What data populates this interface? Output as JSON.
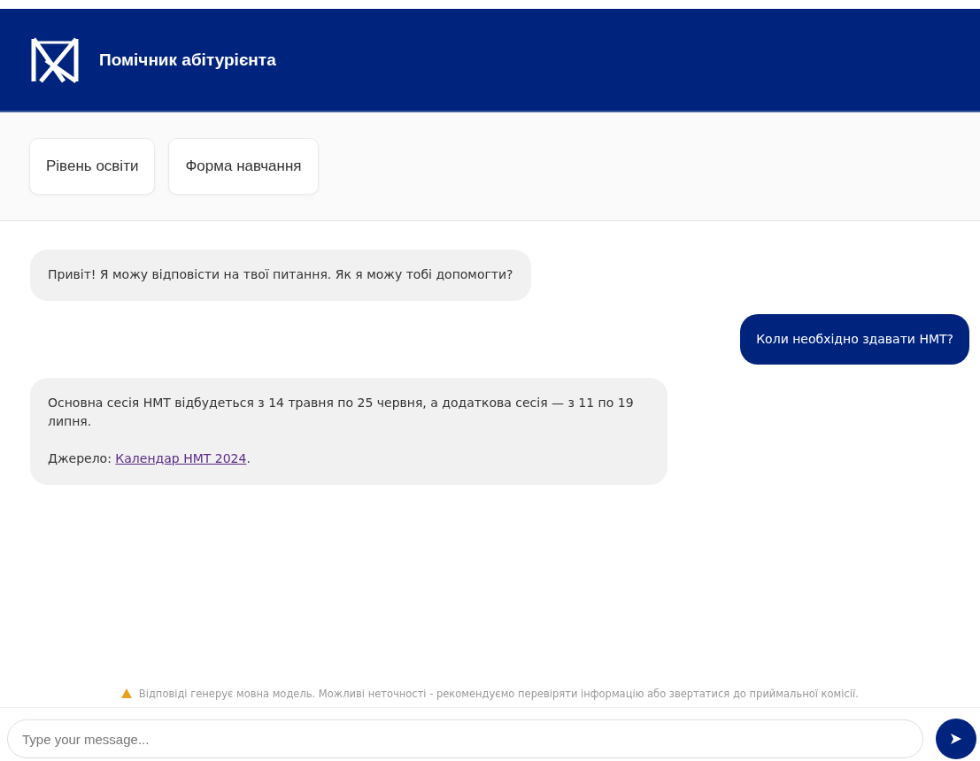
{
  "header": {
    "title": "Помічник абітурієнта"
  },
  "chips": [
    {
      "label": "Рівень освіти"
    },
    {
      "label": "Форма навчання"
    }
  ],
  "messages": [
    {
      "kind": "bot",
      "paragraphs": [
        {
          "text": "Привіт! Я можу відповісти на твої питання. Як я можу тобі допомогти?"
        }
      ]
    },
    {
      "kind": "user",
      "paragraphs": [
        {
          "text": "Коли необхідно здавати НМТ?"
        }
      ]
    },
    {
      "kind": "bot",
      "paragraphs": [
        {
          "text": "Основна сесія НМТ відбудеться з 14 травня по 25 червня, а додаткова сесія — з 11 по 19 липня."
        },
        {
          "text": "Джерело: ",
          "link": "Календар НМТ 2024",
          "after": "."
        }
      ]
    }
  ],
  "disclaimer": "Відповіді генерує мовна модель. Можливі неточності - рекомендуємо перевіряти інформацію або звертатися до приймальної комісії.",
  "input": {
    "placeholder": "Type your message..."
  }
}
